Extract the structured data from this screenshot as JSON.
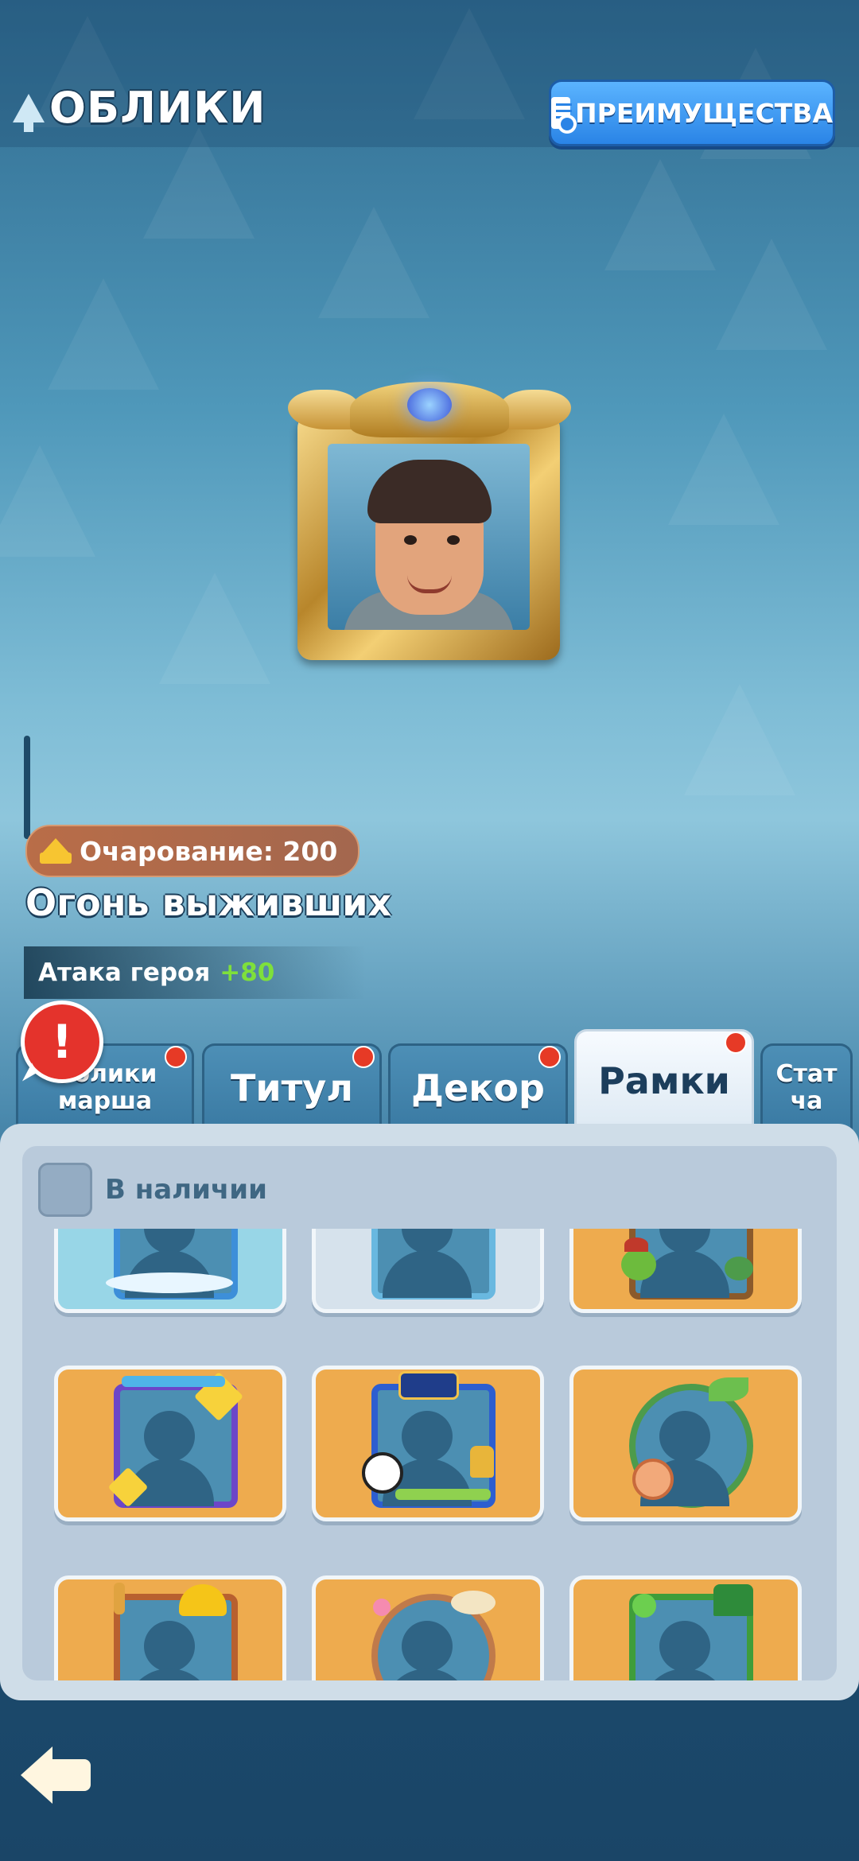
{
  "header": {
    "title": "ОБЛИКИ",
    "benefits_button": "ПРЕИМУЩЕСТВА"
  },
  "profile": {
    "charm_label": "Очарование: 200",
    "frame_name": "Огонь выживших",
    "bonus_label": "Атака героя",
    "bonus_value": "+80"
  },
  "tabs": [
    {
      "label_line1": "Облики",
      "label_line2": "марша",
      "active": false,
      "has_dot": true
    },
    {
      "label": "Титул",
      "active": false,
      "has_dot": true
    },
    {
      "label": "Декор",
      "active": false,
      "has_dot": true
    },
    {
      "label": "Рамки",
      "active": true,
      "has_dot": true
    },
    {
      "label_line1": "Стат",
      "label_line2": "ча",
      "active": false,
      "has_dot": false
    }
  ],
  "alert_icon": "exclamation-alert-icon",
  "filter": {
    "label": "В наличии",
    "checked": false
  },
  "frames_grid": {
    "cards": [
      {
        "name": "frame-ocean",
        "bg": "aqua",
        "frame_color": "#3d8fd9"
      },
      {
        "name": "frame-basic",
        "bg": "gray",
        "frame_color": "#69b8e0"
      },
      {
        "name": "frame-turtle",
        "bg": "orange",
        "frame_color": "#8b5a2b"
      },
      {
        "name": "frame-star-purple",
        "bg": "orange",
        "frame_color": "#6c46c8"
      },
      {
        "name": "frame-football",
        "bg": "orange",
        "frame_color": "#2d5ed0"
      },
      {
        "name": "frame-snail-vine",
        "bg": "orange",
        "frame_color": "#4d9b4b"
      },
      {
        "name": "frame-builder-helmet",
        "bg": "orange",
        "frame_color": "#b8602f"
      },
      {
        "name": "frame-flower-hat",
        "bg": "orange",
        "frame_color": "#c07a4a"
      },
      {
        "name": "frame-clover-leprechaun",
        "bg": "orange",
        "frame_color": "#3f9d3a"
      }
    ]
  },
  "colors": {
    "accent_blue": "#2a84e6",
    "notification_red": "#e63a26",
    "bonus_green": "#7ee03b",
    "card_orange": "#eeab4e"
  }
}
